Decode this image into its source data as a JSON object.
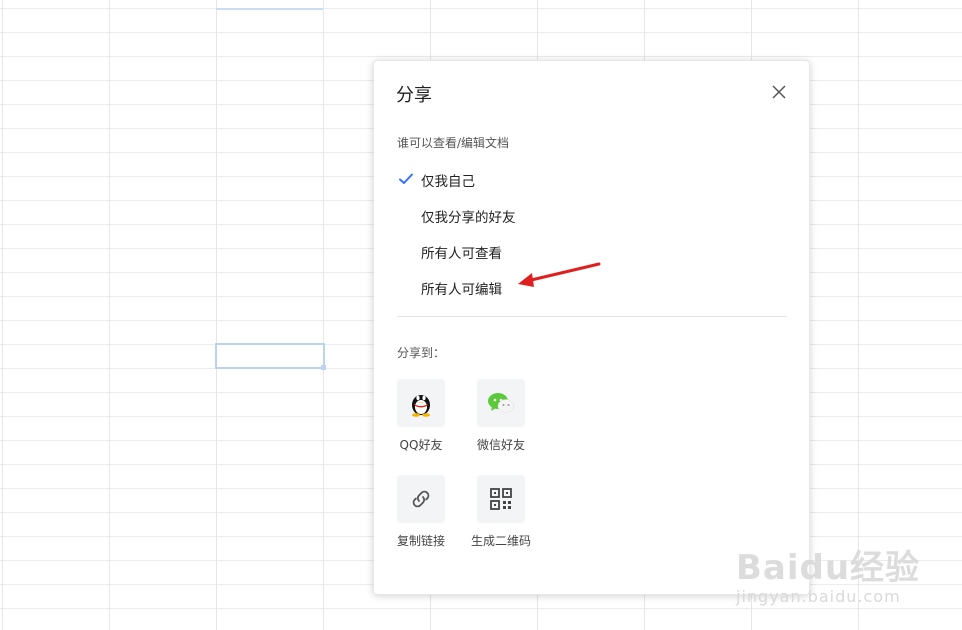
{
  "dialog": {
    "title": "分享",
    "permission_label": "谁可以查看/编辑文档",
    "options": [
      {
        "label": "仅我自己",
        "selected": true
      },
      {
        "label": "仅我分享的好友",
        "selected": false
      },
      {
        "label": "所有人可查看",
        "selected": false
      },
      {
        "label": "所有人可编辑",
        "selected": false
      }
    ],
    "share_to_label": "分享到：",
    "share_targets": [
      {
        "label": "QQ好友",
        "icon": "qq-penguin-icon"
      },
      {
        "label": "微信好友",
        "icon": "wechat-icon"
      },
      {
        "label": "复制链接",
        "icon": "link-icon"
      },
      {
        "label": "生成二维码",
        "icon": "qrcode-icon"
      }
    ]
  },
  "colors": {
    "check": "#3370ff",
    "arrow": "#e02020",
    "selection": "#bcd3ef"
  },
  "watermark": {
    "brand": "Baidu经验",
    "url": "jingyan.baidu.com"
  }
}
